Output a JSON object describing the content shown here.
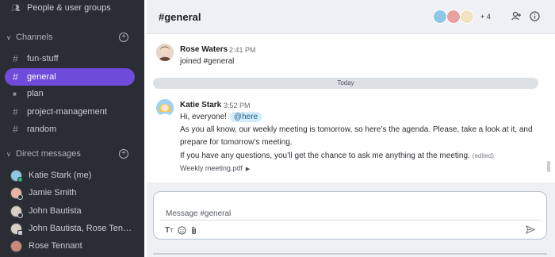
{
  "sidebar": {
    "top_item": "People & user groups",
    "channels_label": "Channels",
    "channels": [
      {
        "label": "fun-stuff",
        "icon": "hash-icon"
      },
      {
        "label": "general",
        "icon": "hash-icon",
        "active": true
      },
      {
        "label": "plan",
        "icon": "lock-icon"
      },
      {
        "label": "project-management",
        "icon": "hash-icon"
      },
      {
        "label": "random",
        "icon": "hash-icon"
      }
    ],
    "dm_label": "Direct messages",
    "dms": [
      {
        "label": "Katie Stark (me)",
        "status": "online"
      },
      {
        "label": "Jamie Smith",
        "status": "offline"
      },
      {
        "label": "John Bautista",
        "status": "offline"
      },
      {
        "label": "John Bautista, Rose Ten…",
        "status": "group"
      },
      {
        "label": "Rose Tennant",
        "status": "none"
      }
    ]
  },
  "header": {
    "title": "#general",
    "member_overflow": "+ 4"
  },
  "messages": [
    {
      "sender": "Rose Waters",
      "time": "2:41 PM",
      "lines": [
        "joined #general"
      ]
    },
    {
      "sender": "Katie Stark",
      "time": "3:52 PM",
      "greeting": "Hi, everyone!",
      "mention": "@here",
      "lines": [
        "As you all know, our weekly meeting is tomorrow, so here’s the agenda. Please, take a look at it, and",
        "prepare for tomorrow’s meeting.",
        "If you have any questions, you’ll get the chance to ask me anything at the meeting."
      ],
      "edited": "(edited)",
      "attachment": "Weekly meeting.pdf"
    }
  ],
  "divider_label": "Today",
  "composer": {
    "placeholder": "Message #general"
  },
  "colors": {
    "sidebar_bg": "#2a2d33",
    "active_channel": "#6e4bd8",
    "online": "#2bb673",
    "mention_bg": "#d3ecfb"
  }
}
